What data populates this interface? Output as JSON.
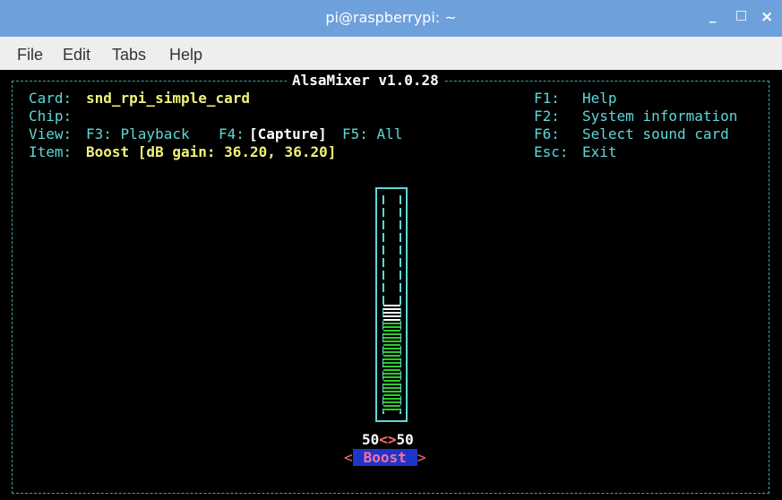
{
  "window": {
    "title": "pi@raspberrypi: ~",
    "buttons": {
      "minimize": "_",
      "maximize": "□",
      "close": "×"
    }
  },
  "menubar": {
    "items": [
      "File",
      "Edit",
      "Tabs",
      "Help"
    ]
  },
  "mixer": {
    "title": "AlsaMixer v1.0.28",
    "card_label": "Card:",
    "card_value": "snd_rpi_simple_card",
    "chip_label": "Chip:",
    "view_label": "View:",
    "view_f3": "F3: Playback",
    "view_f4_key": "F4:",
    "view_f4_value": "[Capture]",
    "view_f5": "F5: All",
    "item_label": "Item:",
    "item_value": "Boost [dB gain: 36.20, 36.20]",
    "help": [
      {
        "key": "F1:",
        "label": "Help"
      },
      {
        "key": "F2:",
        "label": "System information"
      },
      {
        "key": "F6:",
        "label": "Select sound card"
      },
      {
        "key": "Esc:",
        "label": "Exit"
      }
    ],
    "control": {
      "level_left": "50",
      "level_sep": "<>",
      "level_right": "50",
      "name": "Boost",
      "left_arrow": "<",
      "right_arrow": ">",
      "level_fraction": 0.5
    }
  },
  "colors": {
    "titlebar": "#6ea0dc",
    "terminal_bg": "#000000",
    "cyan": "#5fd7d7",
    "bar_green": "#2ec92e",
    "selected_bg": "#1e35c8"
  }
}
